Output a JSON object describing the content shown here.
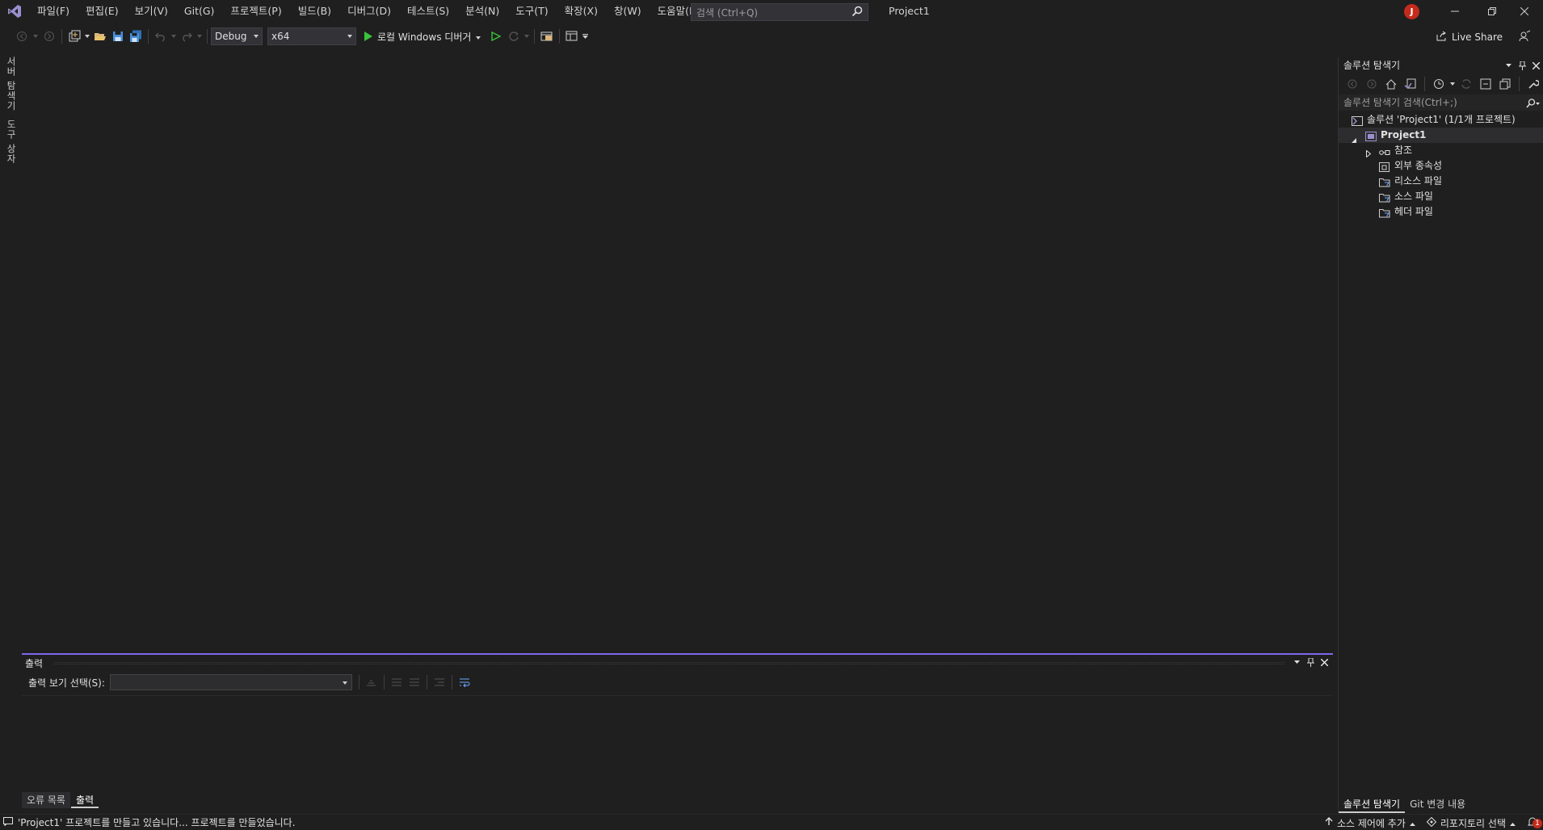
{
  "menu": {
    "items": [
      "파일(F)",
      "편집(E)",
      "보기(V)",
      "Git(G)",
      "프로젝트(P)",
      "빌드(B)",
      "디버그(D)",
      "테스트(S)",
      "분석(N)",
      "도구(T)",
      "확장(X)",
      "창(W)",
      "도움말(H)"
    ]
  },
  "search": {
    "placeholder": "검색 (Ctrl+Q)"
  },
  "window": {
    "project_title": "Project1",
    "user_initial": "J"
  },
  "toolbar": {
    "configuration": "Debug",
    "platform": "x64",
    "debugger": "로컬 Windows 디버거",
    "live_share": "Live Share"
  },
  "left_tabs": {
    "server_explorer": "서버 탐색기",
    "toolbox": "도구 상자"
  },
  "output": {
    "title": "출력",
    "select_label": "출력 보기 선택(S):",
    "select_value": ""
  },
  "bottom_tabs": {
    "error_list": "오류 목록",
    "output": "출력"
  },
  "solution_explorer": {
    "title": "솔루션 탐색기",
    "search_placeholder": "솔루션 탐색기 검색(Ctrl+;)",
    "solution": "솔루션 'Project1' (1/1개 프로젝트)",
    "project": "Project1",
    "nodes": [
      "참조",
      "외부 종속성",
      "리소스 파일",
      "소스 파일",
      "헤더 파일"
    ],
    "tab_solution_explorer": "솔루션 탐색기",
    "tab_git_changes": "Git 변경 내용"
  },
  "status": {
    "message": "'Project1' 프로젝트를 만들고 있습니다... 프로젝트를 만들었습니다.",
    "add_source_control": "소스 제어에 추가",
    "select_repository": "리포지토리 선택",
    "notifications": "1"
  },
  "colors": {
    "accent": "#7b68ee",
    "avatar": "#c42b1c",
    "run": "#3ac33a"
  }
}
